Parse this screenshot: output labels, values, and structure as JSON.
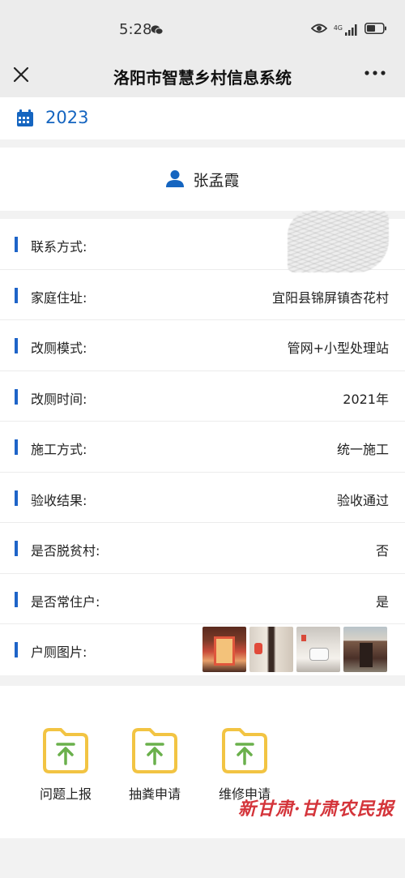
{
  "status": {
    "time": "5:28",
    "network": "4G"
  },
  "nav": {
    "title": "洛阳市智慧乡村信息系统"
  },
  "year": "2023",
  "person": {
    "name": "张孟霞"
  },
  "info": [
    {
      "label": "联系方式:",
      "value": ""
    },
    {
      "label": "家庭住址:",
      "value": "宜阳县锦屏镇杏花村"
    },
    {
      "label": "改厕模式:",
      "value": "管网+小型处理站"
    },
    {
      "label": "改厕时间:",
      "value": "2021年"
    },
    {
      "label": "施工方式:",
      "value": "统一施工"
    },
    {
      "label": "验收结果:",
      "value": "验收通过"
    },
    {
      "label": "是否脱贫村:",
      "value": "否"
    },
    {
      "label": "是否常住户:",
      "value": "是"
    },
    {
      "label": "户厕图片:",
      "value": ""
    }
  ],
  "actions": [
    {
      "label": "问题上报",
      "icon": "folder-upload-icon"
    },
    {
      "label": "抽粪申请",
      "icon": "folder-upload-icon"
    },
    {
      "label": "维修申请",
      "icon": "folder-upload-icon"
    }
  ],
  "watermark": "新甘肃·甘肃农民报",
  "colors": {
    "accent": "#1565c0",
    "label_bar": "#1e64c8",
    "folder": "#f2c443",
    "arrow": "#6ab04c",
    "watermark": "#d4343a"
  }
}
